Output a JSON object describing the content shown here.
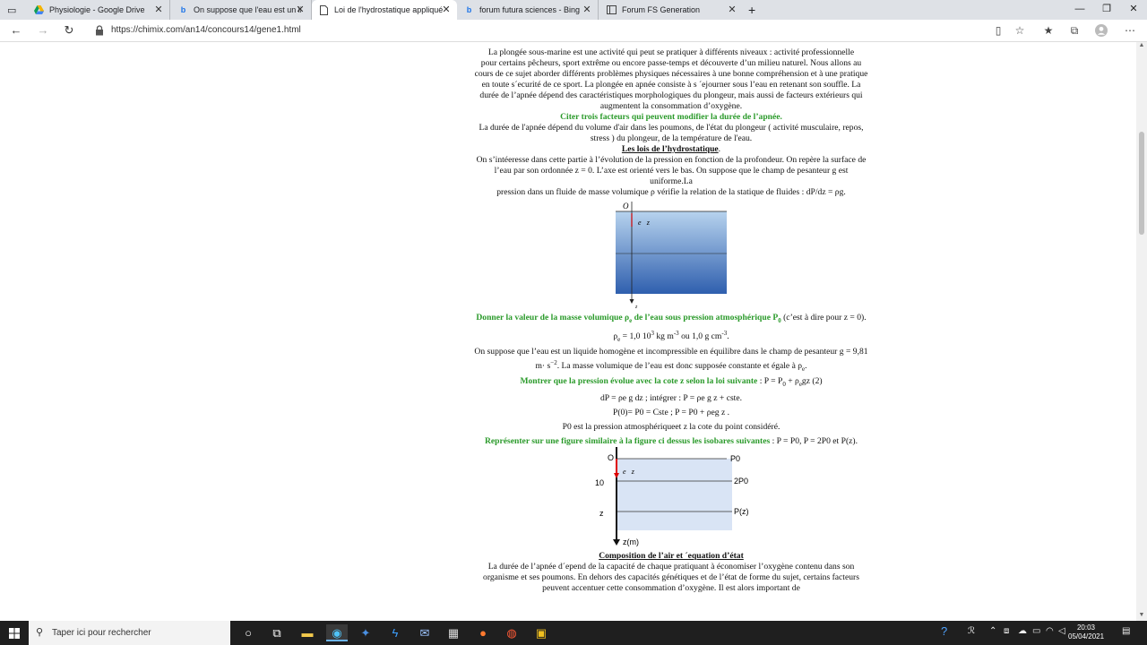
{
  "browser": {
    "tabs": [
      {
        "title": "Physiologie - Google Drive",
        "icon": "google-drive-icon",
        "active": false
      },
      {
        "title": "On suppose que l'eau est un liqu",
        "icon": "bing-icon",
        "active": false
      },
      {
        "title": "Loi de l'hydrostatique appliqué",
        "icon": "page-icon",
        "active": true
      },
      {
        "title": "forum futura sciences - Bing",
        "icon": "bing-icon",
        "active": false
      },
      {
        "title": "Forum FS Generation",
        "icon": "page-icon",
        "active": false
      }
    ],
    "url": "https://chimix.com/an14/concours14/gene1.html"
  },
  "doc": {
    "intro_1": "La plongée sous-marine est une activité qui peut se pratiquer à différents niveaux : activité professionnelle",
    "intro_2": "pour certains pêcheurs, sport extrême ou encore passe-temps et découverte d’un milieu naturel. Nous allons au cours de ce sujet aborder différents problèmes physiques nécessaires à une bonne compréhension et à une pratique en toute s´ecurité de ce sport. La plongée en apnée consiste à s ´ejourner sous l’eau en retenant son souffle. La durée de l’apnée dépend des caractéristiques morphologiques du plongeur, mais aussi de facteurs extérieurs qui augmentent la consommation d’oxygène.",
    "q1": "Citer trois facteurs qui peuvent modifier la durée de l’apnée.",
    "a1": "La durée de l'apnée dépend du volume d'air dans les poumons, de l'état du plongeur ( activité musculaire, repos, stress ) du plongeur, de la température de l'eau.",
    "h1": "Les lois de l’hydrostatique",
    "p1": "On s’intéeresse dans cette partie à l’évolution de la pression en fonction de la profondeur. On repère la surface de l’eau par son ordonnée z = 0. L’axe est orienté vers le bas. On suppose que le champ de pesanteur g est uniforme.La",
    "p2": "pression dans un fluide de masse volumique ρ vérifie la relation de la statique de fluides : dP/dz = ρg.",
    "fig1": {
      "origin": "O",
      "vector": "e⃗z",
      "axis": "z"
    },
    "q2a": "Donner la valeur de la masse volumique ρ",
    "q2b": "e",
    "q2c": " de l’eau sous pression atmosphérique P",
    "q2d": "0",
    "q2e": " (c’est à dire pour z = 0).",
    "a2a": "ρ",
    "a2b": "e",
    "a2c": " = 1,0 10",
    "a2d": "3",
    "a2e": " kg m",
    "a2f": "-3",
    "a2g": " ou 1,0 g cm",
    "a2h": "-3",
    "a2i": ".",
    "p3a": "On suppose que l’eau est un liquide homogène et incompressible en équilibre dans le champ de pesanteur g = 9,81 m· s",
    "p3b": "−2",
    "p3c": ". La masse volumique de l’eau est donc supposée constante et égale à ρ",
    "p3d": "e",
    "p3e": ".",
    "q3a": "Montrer que la pression évolue avec la cote z selon la loi suivante",
    "q3b": " : P = P",
    "q3c": "0",
    "q3d": " + ρ",
    "q3e": "e",
    "q3f": "gz (2)",
    "a3_1": "dP = ρe g dz ; intégrer : P = ρe g z + cste.",
    "a3_2": "P(0)= P0 = Cste ; P = P0 + ρeg z .",
    "a3_3": "P0 est la pression atmosphériqueet z la cote du point considéré.",
    "q4a": "Représenter sur une figure similaire à la figure ci dessus les isobares suivantes",
    "q4b": " : P = P0, P = 2P0 et P(z).",
    "fig2": {
      "origin": "O",
      "vector": "e⃗z",
      "y10": "10",
      "yz": "z",
      "axis": "z(m)",
      "l1": "P0",
      "l2": "2P0",
      "l3": "P(z)"
    },
    "h2": "Composition de l’air et ´equation d’état",
    "p4": "La durée de l’apnée d´epend de la capacité de chaque pratiquant à économiser l’oxygène contenu dans son organisme et ses poumons. En dehors des capacités génétiques et de l’état de forme du sujet, certains facteurs peuvent accentuer cette consommation d’oxygène. Il est alors important de"
  },
  "taskbar": {
    "search_placeholder": "Taper ici pour rechercher",
    "time": "20:03",
    "date": "05/04/2021"
  }
}
